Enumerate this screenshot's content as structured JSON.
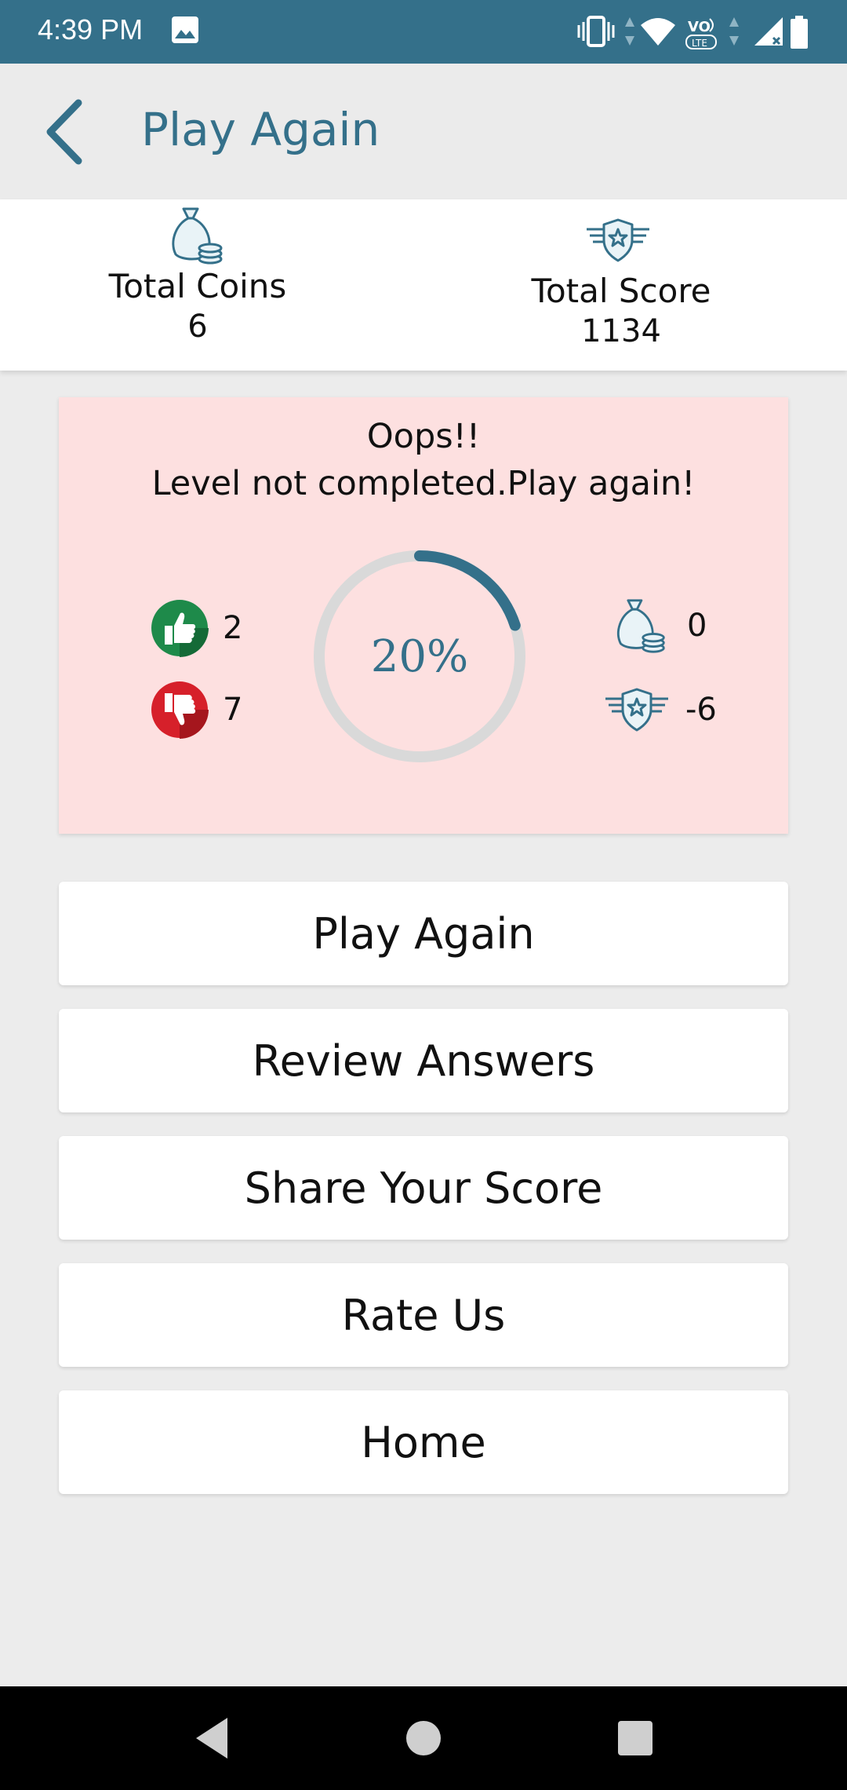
{
  "status_bar": {
    "time": "4:39 PM"
  },
  "app_bar": {
    "title": "Play Again"
  },
  "stats": {
    "coins_label": "Total Coins",
    "coins_value": "6",
    "score_label": "Total Score",
    "score_value": "1134"
  },
  "result": {
    "line1": "Oops!!",
    "line2": "Level not completed.Play again!",
    "correct": "2",
    "wrong": "7",
    "percent_text": "20%",
    "progress": 0.2,
    "coins_earned": "0",
    "score_earned": "-6"
  },
  "actions": [
    {
      "label": "Play Again"
    },
    {
      "label": "Review Answers"
    },
    {
      "label": "Share Your Score"
    },
    {
      "label": "Rate Us"
    },
    {
      "label": "Home"
    }
  ],
  "colors": {
    "primary": "#34708a",
    "result_bg": "#fde0e0",
    "correct": "#1e8a4a",
    "wrong": "#d6202a"
  },
  "icons": [
    "image-icon",
    "vibrate-icon",
    "wifi-icon",
    "volte-icon",
    "signal-icon",
    "battery-icon",
    "back-arrow-icon",
    "coin-bag-icon",
    "score-badge-icon",
    "thumbs-up-icon",
    "thumbs-down-icon"
  ]
}
